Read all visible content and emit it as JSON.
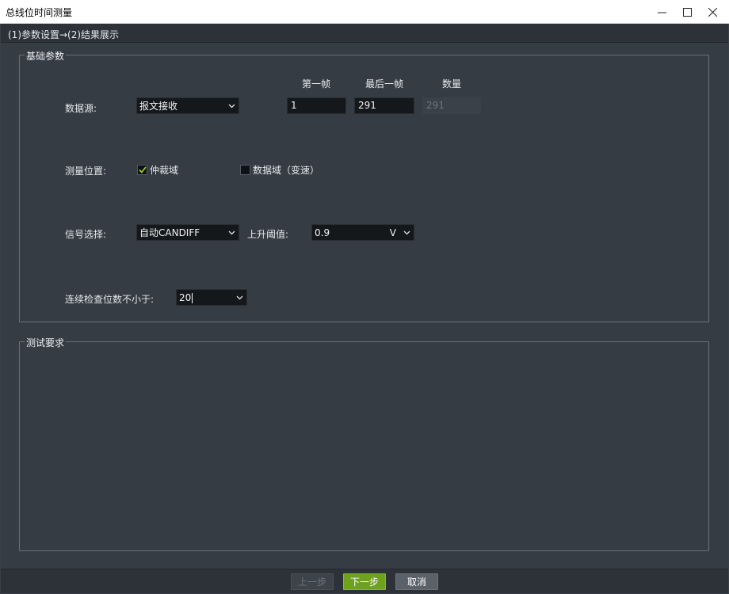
{
  "window": {
    "title": "总线位时间测量"
  },
  "wizard": {
    "steps": "(1)参数设置→(2)结果展示"
  },
  "basic_params": {
    "legend": "基础参数",
    "columns": {
      "first_frame": "第一帧",
      "last_frame": "最后一帧",
      "count": "数量"
    },
    "data_source": {
      "label": "数据源:",
      "value": "报文接收",
      "first_frame": "1",
      "last_frame": "291",
      "count": "291"
    },
    "measure_position": {
      "label": "测量位置:",
      "arbitration": {
        "label": "仲裁域",
        "checked": true
      },
      "data_field": {
        "label": "数据域（变速）",
        "checked": false
      }
    },
    "signal": {
      "label": "信号选择:",
      "value": "自动CANDIFF",
      "threshold_label": "上升阈值:",
      "threshold_value": "0.9",
      "threshold_unit": "V"
    },
    "consecutive": {
      "label": "连续检查位数不小于:",
      "value": "20"
    }
  },
  "test_requirements": {
    "legend": "测试要求"
  },
  "footer": {
    "prev_label": "上一步",
    "next_label": "下一步",
    "cancel_label": "取消"
  },
  "colors": {
    "accent_green": "#6ea11f",
    "panel": "#353c44",
    "field_bg": "#15181b"
  }
}
